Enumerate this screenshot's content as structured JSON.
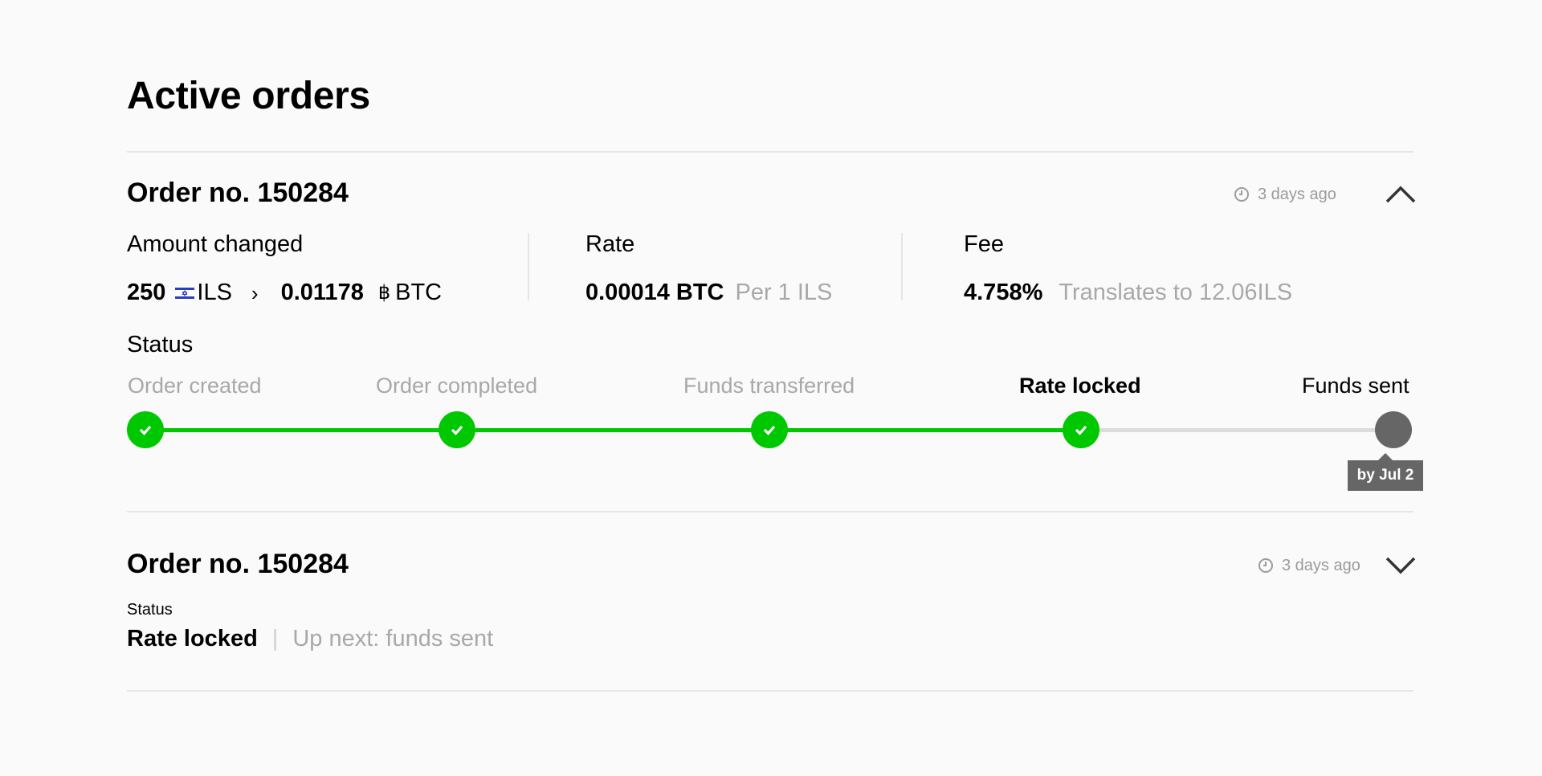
{
  "page": {
    "title": "Active orders"
  },
  "orders": [
    {
      "title": "Order no. 150284",
      "time_ago": "3 days ago",
      "expanded": true,
      "amount": {
        "label": "Amount changed",
        "from_value": "250",
        "from_currency": "ILS",
        "arrow": "›",
        "to_value": "0.01178",
        "to_symbol": "฿",
        "to_currency": "BTC"
      },
      "rate": {
        "label": "Rate",
        "value": "0.00014 BTC",
        "note": "Per 1 ILS"
      },
      "fee": {
        "label": "Fee",
        "value": "4.758%",
        "note": "Translates to 12.06ILS"
      },
      "status": {
        "label": "Status",
        "steps": [
          {
            "label": "Order created",
            "state": "done"
          },
          {
            "label": "Order completed",
            "state": "done"
          },
          {
            "label": "Funds transferred",
            "state": "done"
          },
          {
            "label": "Rate locked",
            "state": "current"
          },
          {
            "label": "Funds sent",
            "state": "upcoming"
          }
        ],
        "eta_tooltip": "by Jul 2"
      }
    },
    {
      "title": "Order no. 150284",
      "time_ago": "3 days ago",
      "expanded": false,
      "status": {
        "label": "Status",
        "current": "Rate locked",
        "next": "Up next: funds sent"
      }
    }
  ],
  "colors": {
    "accent_green": "#00c800",
    "pending_gray": "#666666",
    "muted_text": "#a8a8a8",
    "divider": "#e6e6e6"
  },
  "icons": {
    "clock": "clock-icon",
    "collapse": "chevron-up-icon",
    "expand": "chevron-down-icon",
    "check": "check-icon",
    "flag": "israel-flag-icon",
    "bitcoin": "bitcoin-icon"
  }
}
